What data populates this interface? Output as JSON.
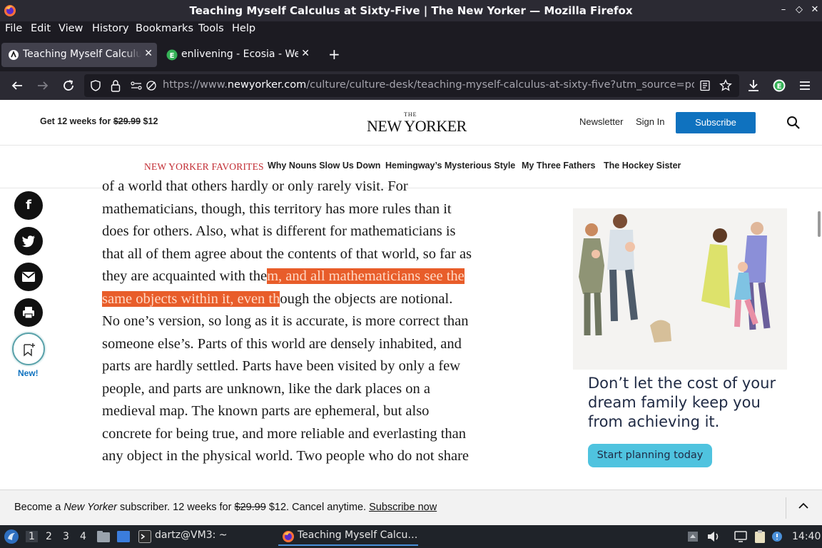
{
  "window": {
    "title": "Teaching Myself Calculus at Sixty-Five | The New Yorker — Mozilla Firefox",
    "controls": [
      "–",
      "◇",
      "✕"
    ]
  },
  "menu": [
    "File",
    "Edit",
    "View",
    "History",
    "Bookmarks",
    "Tools",
    "Help"
  ],
  "tabs": [
    {
      "label": "Teaching Myself Calculus at Sixty-Five",
      "active": true
    },
    {
      "label": "enlivening - Ecosia - Web",
      "active": false
    }
  ],
  "tab_icons": {
    "close": "✕",
    "new_tab": "+"
  },
  "nav": {
    "url_prefix": "https://www.",
    "url_host": "newyorker.com",
    "url_path": "/culture/culture-desk/teaching-myself-calculus-at-sixty-five?utm_source=pocket"
  },
  "site": {
    "promo_prefix": "Get 12 weeks for ",
    "promo_old_price": "$29.99",
    "promo_new_price": " $12",
    "logo_the": "THE",
    "logo_name": "NEW YORKER",
    "newsletter": "Newsletter",
    "sign_in": "Sign In",
    "subscribe": "Subscribe"
  },
  "favorites": {
    "title": "NEW YORKER FAVORITES",
    "links": [
      "Why Nouns Slow Us Down",
      "Hemingway’s Mysterious Style",
      "My Three Fathers",
      "The Hockey Sister"
    ]
  },
  "share": {
    "facebook": "f",
    "save_new": "New!"
  },
  "article": {
    "lines": [
      {
        "pre": "of a world that others hardly or only rarely visit. For",
        "hl": "",
        "post": ""
      },
      {
        "pre": "mathematicians, though, this territory has more rules than it",
        "hl": "",
        "post": ""
      },
      {
        "pre": "does for others. Also, what is different for mathematicians is",
        "hl": "",
        "post": ""
      },
      {
        "pre": "that all of them agree about the contents of that world, so far as",
        "hl": "",
        "post": ""
      },
      {
        "pre": "they are acquainted with the",
        "hl": "m, and all mathematicians see the",
        "post": ""
      },
      {
        "pre": "",
        "hl": "same objects within it, even th",
        "post": "ough the objects are notional."
      },
      {
        "pre": "No one’s version, so long as it is accurate, is more correct than",
        "hl": "",
        "post": ""
      },
      {
        "pre": "someone else’s. Parts of this world are densely inhabited, and",
        "hl": "",
        "post": ""
      },
      {
        "pre": "parts are hardly settled. Parts have been visited by only a few",
        "hl": "",
        "post": ""
      },
      {
        "pre": "people, and parts are unknown, like the dark places on a",
        "hl": "",
        "post": ""
      },
      {
        "pre": "medieval map. The known parts are ephemeral, but also",
        "hl": "",
        "post": ""
      },
      {
        "pre": "concrete for being true, and more reliable and everlasting than",
        "hl": "",
        "post": ""
      },
      {
        "pre": "any object in the physical world. Two people who do not share",
        "hl": "",
        "post": ""
      }
    ]
  },
  "ad": {
    "headline": "Don’t let the cost of your dream family keep you from achieving it.",
    "cta": "Start planning today"
  },
  "promo_bar": {
    "prefix": "Become a ",
    "brand": "New Yorker",
    "middle": " subscriber. 12 weeks for ",
    "old_price": "$29.99",
    "suffix": " $12. Cancel anytime. ",
    "link": "Subscribe now"
  },
  "taskbar": {
    "workspaces": [
      "1",
      "2",
      "3",
      "4"
    ],
    "terminal": "dartz@VM3: ~",
    "firefox": "Teaching Myself Calcu…",
    "clock": "14:40"
  }
}
